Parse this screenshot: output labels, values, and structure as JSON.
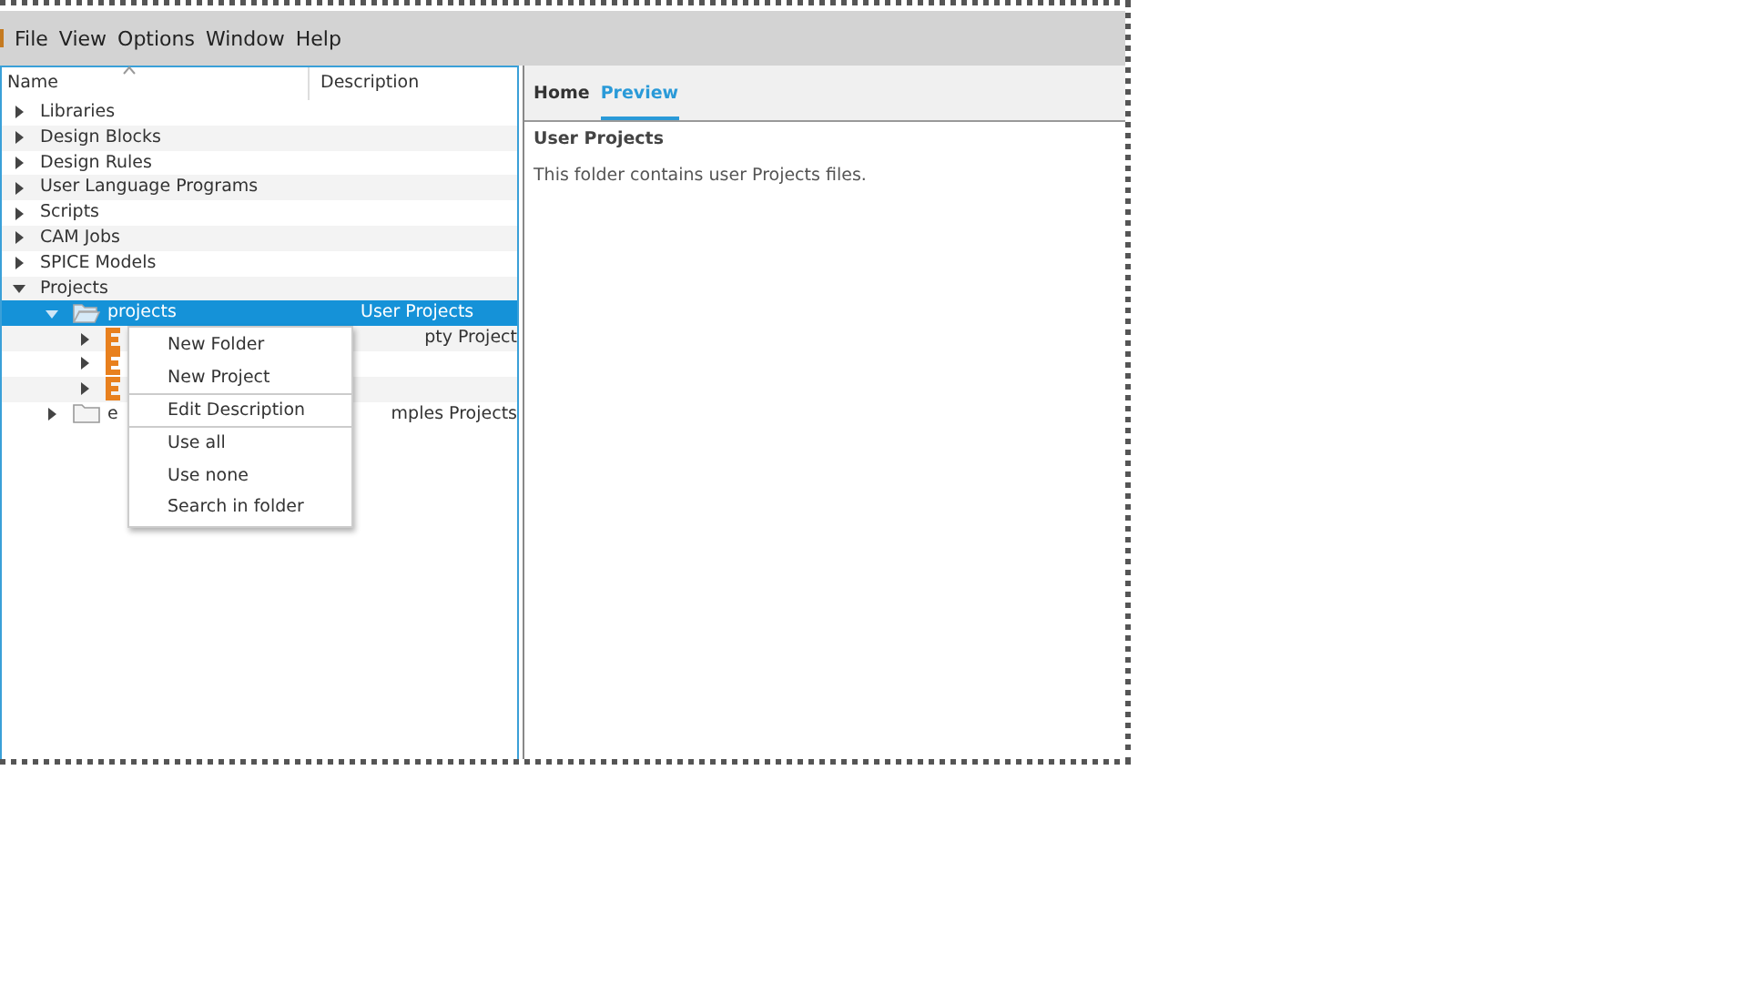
{
  "menu_bar": {
    "items": [
      "File",
      "View",
      "Options",
      "Window",
      "Help"
    ]
  },
  "tree": {
    "columns": [
      "Name",
      "Description"
    ],
    "items": [
      {
        "name": "Libraries",
        "expanded": false,
        "selected": false
      },
      {
        "name": "Design Blocks",
        "expanded": false,
        "selected": false
      },
      {
        "name": "Design Rules",
        "expanded": false,
        "selected": false
      },
      {
        "name": "User Language Programs",
        "expanded": false,
        "selected": false
      },
      {
        "name": "Scripts",
        "expanded": false,
        "selected": false
      },
      {
        "name": "CAM Jobs",
        "expanded": false,
        "selected": false
      },
      {
        "name": "SPICE Models",
        "expanded": false,
        "selected": false
      },
      {
        "name": "Projects",
        "expanded": true,
        "selected": false,
        "children": [
          {
            "name": "projects",
            "kind": "folder",
            "description": "User Projects",
            "expanded": true,
            "selected": true,
            "children": [
              {
                "kind": "project",
                "description": "pty Project",
                "expanded": false,
                "selected": false
              },
              {
                "kind": "project",
                "expanded": false,
                "selected": false
              },
              {
                "kind": "project",
                "expanded": false,
                "selected": false
              }
            ]
          },
          {
            "name": "e",
            "kind": "folder",
            "description": "mples Projects",
            "expanded": false,
            "selected": false
          }
        ]
      }
    ]
  },
  "context_menu": {
    "items": [
      {
        "kind": "item",
        "label": "New Folder"
      },
      {
        "kind": "item",
        "label": "New Project"
      },
      {
        "kind": "separator"
      },
      {
        "kind": "item",
        "label": "Edit Description"
      },
      {
        "kind": "separator"
      },
      {
        "kind": "item",
        "label": "Use all"
      },
      {
        "kind": "item",
        "label": "Use none"
      },
      {
        "kind": "item",
        "label": "Search in folder"
      }
    ]
  },
  "preview": {
    "tabs": [
      {
        "label": "Home",
        "selected": false
      },
      {
        "label": "Preview",
        "selected": true
      }
    ],
    "title": "User Projects",
    "text": "This folder contains user Projects files."
  }
}
